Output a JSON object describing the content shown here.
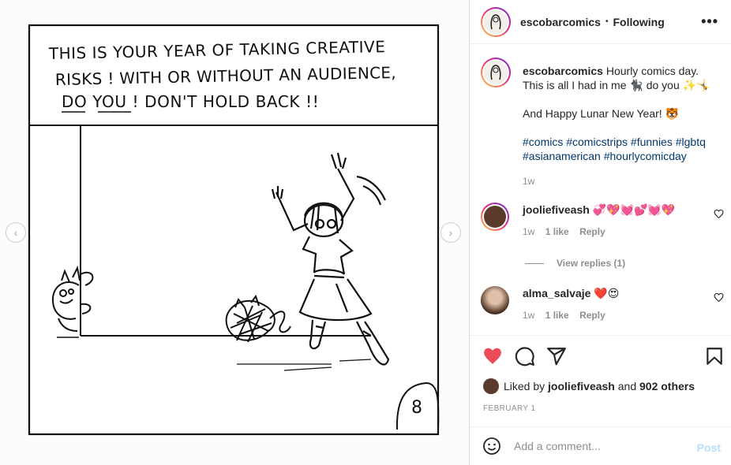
{
  "post": {
    "comic_lines": [
      "THIS IS YOUR YEAR OF TAKING CREATIVE",
      "RISKS ! WITH OR WITHOUT AN AUDIENCE,",
      "DO YOU !  DON'T HOLD BACK !!"
    ],
    "panel_number": "8"
  },
  "header": {
    "username": "escobarcomics",
    "dot": "•",
    "follow_label": "Following",
    "more_label": "•••"
  },
  "caption": {
    "username": "escobarcomics",
    "text1": "Hourly comics day. This is all I had in me 🐈‍⬛ do you ✨🤸",
    "text2": "And Happy Lunar New Year! 🐯",
    "tags1": "#comics #comicstrips #funnies #lgbtq",
    "tags2": "#asianamerican #hourlycomicday",
    "age": "1w"
  },
  "comments": [
    {
      "username": "jooliefiveash",
      "text": "💞💖💓💕💓💖",
      "age": "1w",
      "likes": "1 like",
      "reply": "Reply"
    },
    {
      "username": "alma_salvaje",
      "text": "❤️😍",
      "age": "1w",
      "likes": "1 like",
      "reply": "Reply"
    }
  ],
  "view_replies": "View replies (1)",
  "likes": {
    "prefix": "Liked by",
    "user": "jooliefiveash",
    "joiner": "and",
    "others": "902 others"
  },
  "date": "FEBRUARY 1",
  "add_comment": {
    "placeholder": "Add a comment...",
    "post_label": "Post"
  },
  "colors": {
    "like_red": "#ed4956",
    "link_blue": "#00376b",
    "post_disabled": "#b2dffc",
    "ring_gradient": [
      "#f9ce34",
      "#ee2a7b",
      "#6228d7"
    ]
  },
  "icons": [
    "chevron-left-icon",
    "chevron-right-icon",
    "more-icon",
    "heart-filled-icon",
    "comment-icon",
    "share-icon",
    "bookmark-icon",
    "heart-outline-icon",
    "smiley-icon"
  ]
}
